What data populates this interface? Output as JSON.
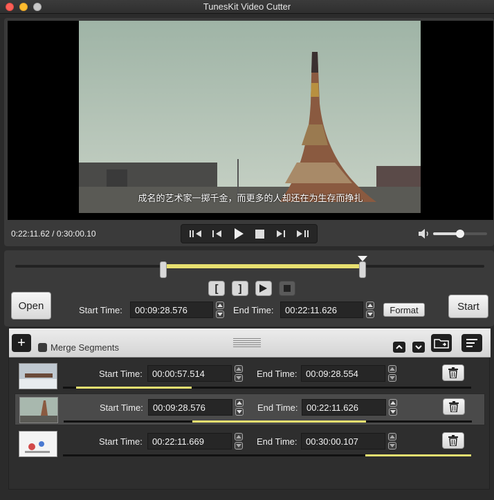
{
  "window": {
    "title": "TunesKit Video Cutter"
  },
  "player": {
    "subtitle": "成名的艺术家一掷千金，而更多的人却还在为生存而挣扎",
    "timecode": "0:22:11.62 / 0:30:00.10",
    "volume": 0.5
  },
  "editor": {
    "open_label": "Open",
    "start_label": "Start",
    "format_label": "Format",
    "start_time_label": "Start Time:",
    "end_time_label": "End Time:",
    "start_time": "00:09:28.576",
    "end_time": "00:22:11.626",
    "selection": {
      "start_fraction": 0.316,
      "end_fraction": 0.74
    },
    "playhead_fraction": 0.74
  },
  "segments": {
    "merge_label": "Merge Segments",
    "merge_checked": false,
    "start_time_label": "Start Time:",
    "end_time_label": "End Time:",
    "items": [
      {
        "start": "00:00:57.514",
        "end": "00:09:28.554",
        "fill_start": 0.032,
        "fill_end": 0.316,
        "selected": false
      },
      {
        "start": "00:09:28.576",
        "end": "00:22:11.626",
        "fill_start": 0.316,
        "fill_end": 0.74,
        "selected": true
      },
      {
        "start": "00:22:11.669",
        "end": "00:30:00.107",
        "fill_start": 0.74,
        "fill_end": 1.0,
        "selected": false
      }
    ]
  },
  "colors": {
    "accent": "#e8e070",
    "panel": "#3a3a3a",
    "background": "#2b2b2b"
  }
}
